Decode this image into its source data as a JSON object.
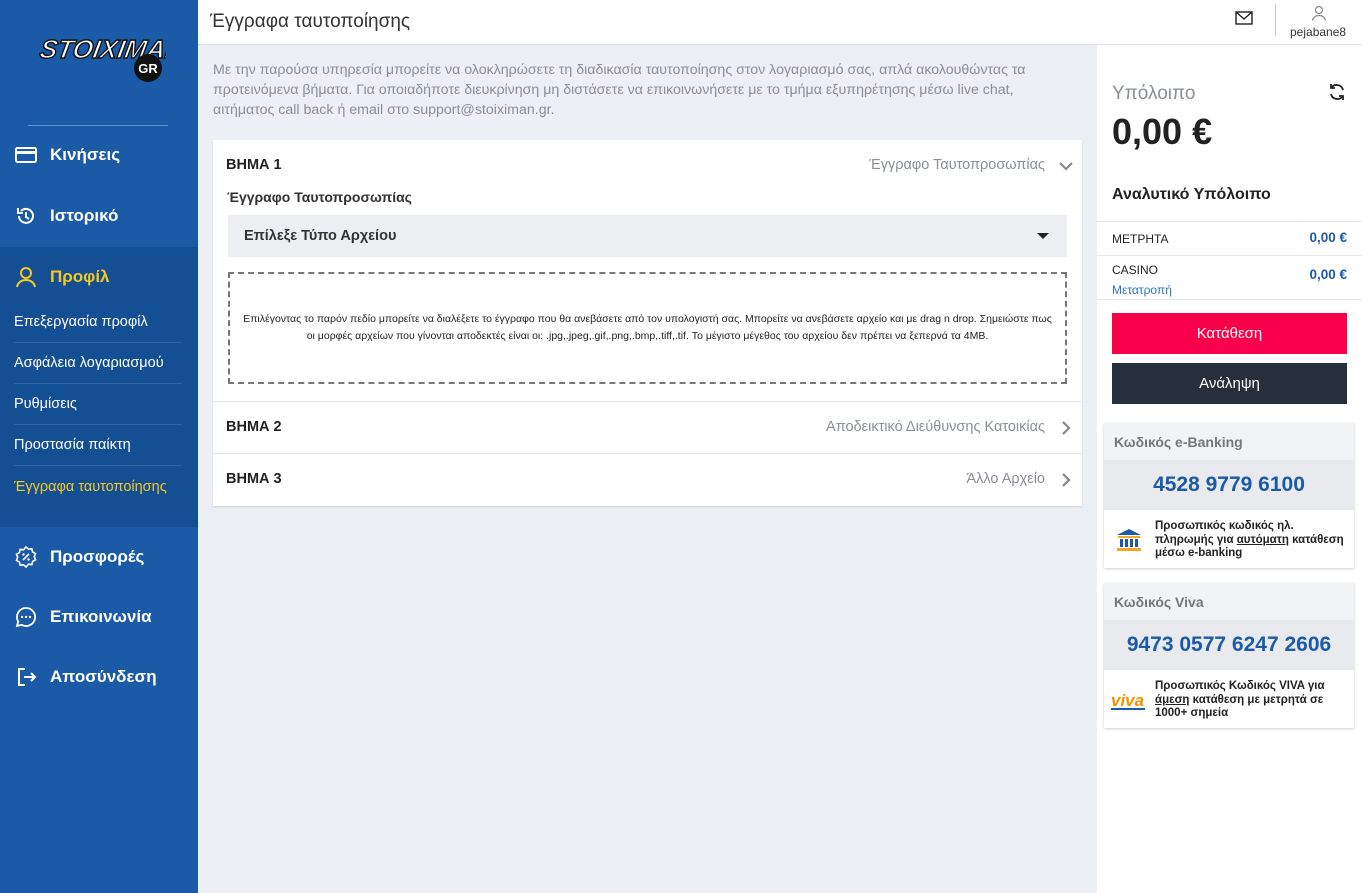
{
  "brand": {
    "logo_text": "STOIXIMAN",
    "logo_badge": "GR"
  },
  "header": {
    "title": "Έγγραφα ταυτοποίησης",
    "username": "pejabane8"
  },
  "sidebar": {
    "items": [
      {
        "label": "Κινήσεις",
        "icon": "card-icon"
      },
      {
        "label": "Ιστορικό",
        "icon": "history-icon"
      },
      {
        "label": "Προφίλ",
        "icon": "user-icon"
      },
      {
        "label": "Προσφορές",
        "icon": "percent-badge-icon"
      },
      {
        "label": "Επικοινωνία",
        "icon": "chat-icon"
      },
      {
        "label": "Αποσύνδεση",
        "icon": "logout-icon"
      }
    ],
    "profile_sub": [
      "Επεξεργασία προφίλ",
      "Ασφάλεια λογαριασμού",
      "Ρυθμίσεις",
      "Προστασία παίκτη",
      "Έγγραφα ταυτοποίησης"
    ],
    "active_sub": "Έγγραφα ταυτοποίησης"
  },
  "main": {
    "intro": "Με την παρούσα υπηρεσία μπορείτε να ολοκληρώσετε τη διαδικασία ταυτοποίησης στον λογαριασμό σας, απλά ακολουθώντας τα προτεινόμενα βήματα. Για οποιαδήποτε διευκρίνηση μη διστάσετε να επικοινωνήσετε με το τμήμα εξυπηρέτησης μέσω live chat, αιτήματος call back ή email στο support@stoiximan.gr.",
    "steps": [
      {
        "title": "ΒΗΜΑ 1",
        "name": "Έγγραφο Ταυτοπροσωπίας"
      },
      {
        "title": "ΒΗΜΑ 2",
        "name": "Αποδεικτικό Διεύθυνσης Κατοικίας"
      },
      {
        "title": "ΒΗΜΑ 3",
        "name": "Άλλο Αρχείο"
      }
    ],
    "doc_label": "Έγγραφο Ταυτοπροσωπίας",
    "select_value": "Επίλεξε Τύπο Αρχείου",
    "dropzone_text": "Επιλέγοντας το παρόν πεδίο μπορείτε να διαλέξετε το έγγραφο που θα ανεβάσετε από τον υπολογιστή σας. Μπορείτε να ανεβάσετε αρχείο και με drag n drop. Σημειώστε πως οι μορφές αρχείων που γίνονται αποδεκτές είναι οι: .jpg,.jpeg,.gif,.png,.bmp,.tiff,.tif. Το μέγιστο μέγεθος του αρχείου δεν πρέπει να ξεπερνά τα 4MB."
  },
  "balance": {
    "label": "Υπόλοιπο",
    "value": "0,00 €",
    "analytic_title": "Αναλυτικό Υπόλοιπο",
    "cash_label": "ΜΕΤΡΗΤΑ",
    "cash_value": "0,00 €",
    "casino_label": "CASINO",
    "casino_value": "0,00 €",
    "convert_link": "Μετατροπή",
    "deposit_button": "Κατάθεση",
    "withdraw_button": "Ανάληψη"
  },
  "ebanking": {
    "title": "Κωδικός e-Banking",
    "code": "4528 9779 6100",
    "desc_pre": "Προσωπικός κωδικός ηλ. πληρωμής για ",
    "desc_u": "αυτόματη",
    "desc_post": " κατάθεση μέσω e-banking"
  },
  "viva": {
    "title": "Κωδικός Viva",
    "code": "9473 0577 6247 2606",
    "desc_pre": "Προσωπικός Κωδικός VIVA για ",
    "desc_u": "άμεση",
    "desc_post": " κατάθεση με μετρητά σε 1000+ σημεία",
    "logo_text": "viva"
  },
  "colors": {
    "sidebar": "#1a5aa6",
    "accent_yellow": "#f5c824",
    "deposit": "#f8004a",
    "withdraw": "#262f3c",
    "link_blue": "#2b74c4"
  }
}
